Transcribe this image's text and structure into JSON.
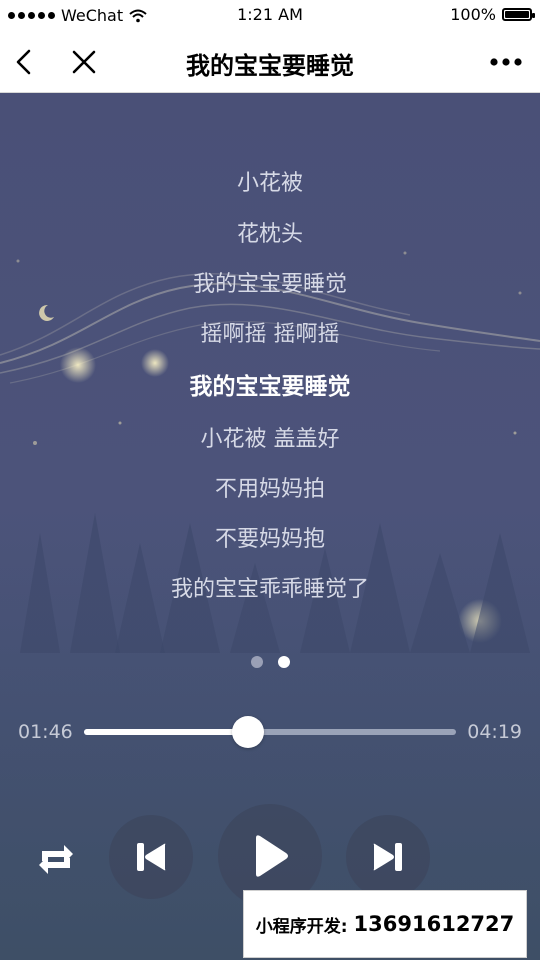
{
  "status_bar": {
    "carrier": "WeChat",
    "time": "1:21 AM",
    "battery": "100%"
  },
  "nav": {
    "title": "我的宝宝要睡觉",
    "back_icon": "chevron-left-icon",
    "close_icon": "close-icon",
    "more_icon": "more-dots-icon"
  },
  "lyrics": {
    "lines": [
      "小花被",
      "花枕头",
      "我的宝宝要睡觉",
      "摇啊摇  摇啊摇",
      "我的宝宝要睡觉",
      "小花被  盖盖好",
      "不用妈妈拍",
      "不要妈妈抱",
      "我的宝宝乖乖睡觉了"
    ],
    "current_index": 4
  },
  "pager": {
    "count": 2,
    "active_index": 1
  },
  "playback": {
    "current_time": "01:46",
    "total_time": "04:19",
    "progress": 0.44
  },
  "controls": {
    "repeat_icon": "repeat-icon",
    "prev_icon": "previous-track-icon",
    "play_icon": "play-icon",
    "next_icon": "next-track-icon"
  },
  "watermark": {
    "label": "小程序开发:",
    "phone": "13691612727"
  },
  "colors": {
    "background_top": "#4a5077",
    "background_bottom": "#45566f",
    "lyric": "#d6d9e6",
    "lyric_current": "#ffffff",
    "progress_fill": "#ffffff",
    "progress_track": "#9aa3b8"
  }
}
